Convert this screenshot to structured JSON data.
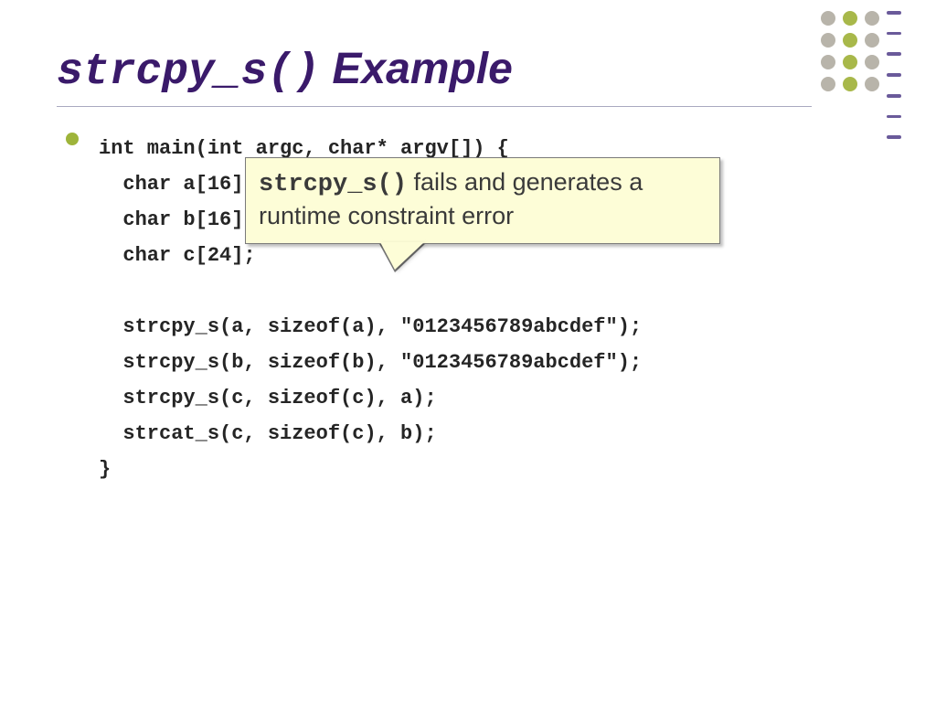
{
  "title": {
    "code": "strcpy_s()",
    "rest": " Example"
  },
  "code": {
    "line1": "int main(int argc, char* argv[]) {",
    "line2": "  char a[16];",
    "line3": "  char b[16];",
    "line4": "  char c[24];",
    "line5": "",
    "line6": "  strcpy_s(a, sizeof(a), \"0123456789abcdef\");",
    "line7": "  strcpy_s(b, sizeof(b), \"0123456789abcdef\");",
    "line8": "  strcpy_s(c, sizeof(c), a);",
    "line9": "  strcat_s(c, sizeof(c), b);",
    "line10": "}"
  },
  "callout": {
    "code": "strcpy_s()",
    "text": " fails and generates a runtime constraint error"
  }
}
